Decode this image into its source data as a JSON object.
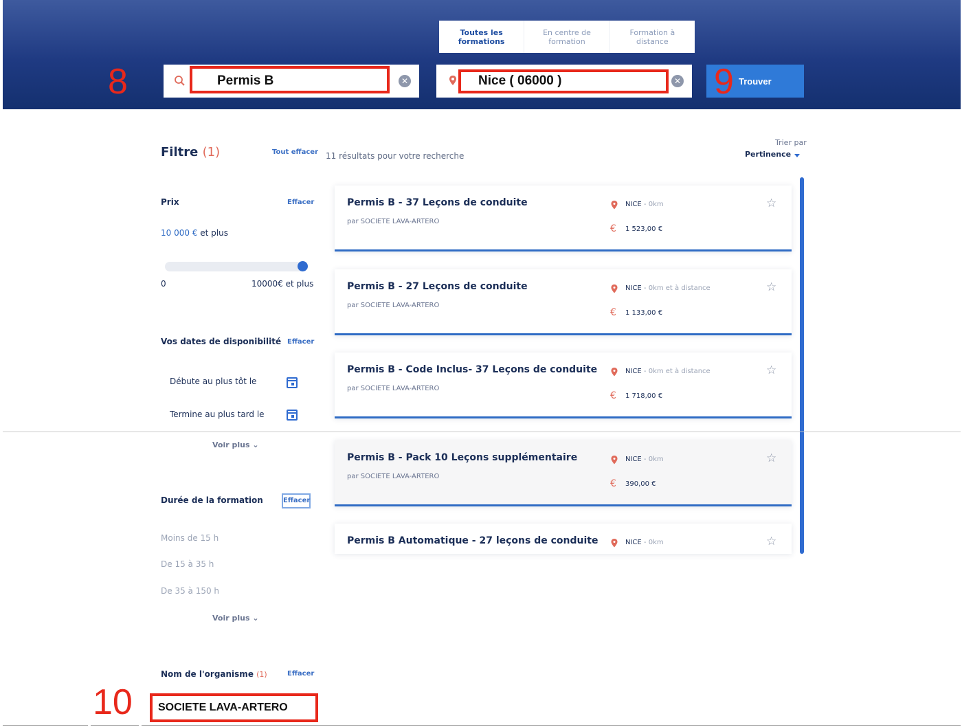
{
  "tabs": [
    {
      "label": "Toutes les\nformations",
      "active": true
    },
    {
      "label": "En centre de\nformation",
      "active": false
    },
    {
      "label": "Formation à\ndistance",
      "active": false
    }
  ],
  "search": {
    "query_value": "Permis B",
    "location_value": "Nice ( 06000 )",
    "submit_label": "Trouver"
  },
  "annotations": {
    "search_marker": "8",
    "submit_marker": "9",
    "org_marker": "10"
  },
  "filters": {
    "title": "Filtre",
    "count": "(1)",
    "clear_all": "Tout effacer",
    "price": {
      "label": "Prix",
      "clear": "Effacer",
      "value_amount": "10 000 €",
      "value_suffix": " et plus",
      "slider_min": "0",
      "slider_max": "10000€ et plus",
      "slider_fraction": 1.0
    },
    "dates": {
      "label": "Vos dates de disponibilité",
      "clear": "Effacer",
      "start": "Débute au plus tôt le",
      "end": "Termine au plus tard le",
      "more": "Voir plus"
    },
    "duration": {
      "label": "Durée de la formation",
      "clear": "Effacer",
      "options": [
        "Moins de 15 h",
        "De 15 à 35 h",
        "De 35 à 150 h"
      ],
      "more": "Voir plus"
    },
    "organism": {
      "label": "Nom de l'organisme",
      "count": "(1)",
      "clear": "Effacer",
      "value": "SOCIETE LAVA-ARTERO"
    }
  },
  "results": {
    "count_text": "11 résultats pour votre recherche",
    "sort_label": "Trier par",
    "sort_value": "Pertinence",
    "items": [
      {
        "title": "Permis B - 37 Leçons de conduite",
        "org": "par SOCIETE LAVA-ARTERO",
        "city": "NICE",
        "distance": " - 0km",
        "price": "1 523,00 €"
      },
      {
        "title": "Permis B - 27 Leçons de conduite",
        "org": "par SOCIETE LAVA-ARTERO",
        "city": "NICE",
        "distance": " - 0km et à distance",
        "price": "1 133,00 €"
      },
      {
        "title": "Permis B - Code Inclus- 37 Leçons de conduite",
        "org": "par SOCIETE LAVA-ARTERO",
        "city": "NICE",
        "distance": " - 0km et à distance",
        "price": "1 718,00 €"
      },
      {
        "title": "Permis B - Pack 10 Leçons supplémentaire",
        "org": "par SOCIETE LAVA-ARTERO",
        "city": "NICE",
        "distance": " - 0km",
        "price": "390,00 €"
      },
      {
        "title": "Permis B Automatique - 27 leçons de conduite",
        "org": "",
        "city": "NICE",
        "distance": " - 0km",
        "price": ""
      }
    ]
  },
  "colors": {
    "header": "#1f3a82",
    "accent": "#2f6bd0",
    "annotation": "#e8281b",
    "cta": "#2f7ad8"
  },
  "icons": [
    "search-icon",
    "map-pin-icon",
    "clear-icon",
    "calendar-icon",
    "chevron-down-icon",
    "star-icon",
    "euro-icon"
  ]
}
